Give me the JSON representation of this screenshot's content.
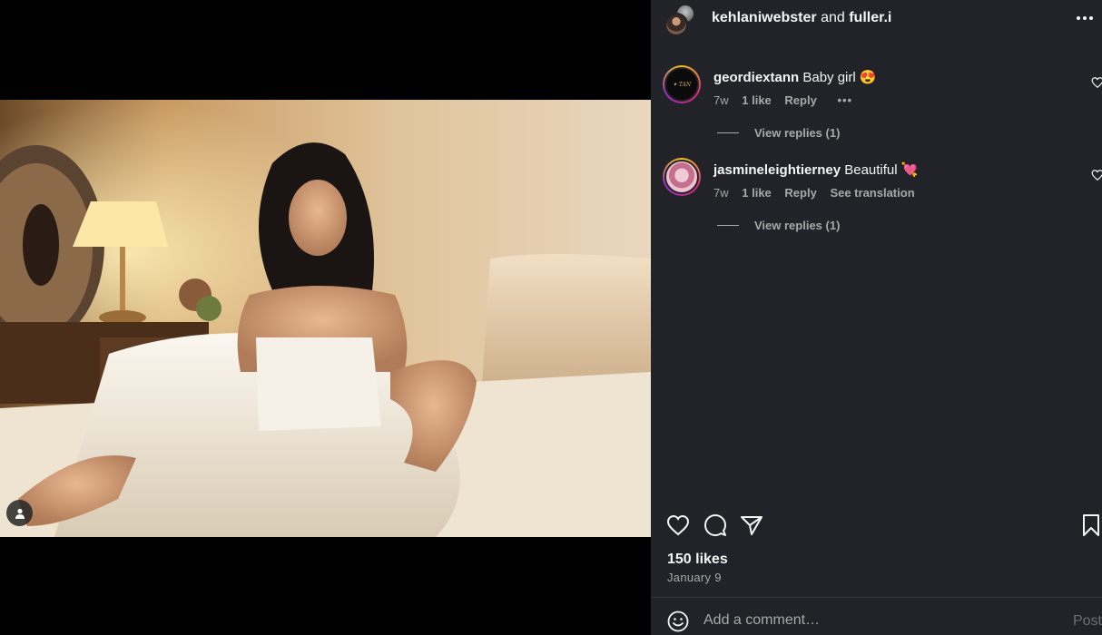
{
  "post": {
    "author": "kehlaniwebster",
    "connector": "and",
    "coauthor": "fuller.i",
    "more_icon": "more-horizontal-icon"
  },
  "media": {
    "alt": "Woman wrapped in white satin sheet sitting on a bed beside a lamp",
    "tag_icon": "user-tag-icon"
  },
  "comments": [
    {
      "user": "geordiextann",
      "text": "Baby girl",
      "emoji": "😍",
      "age": "7w",
      "likes": "1 like",
      "reply": "Reply",
      "extra": "•••",
      "replies": "View replies (1)"
    },
    {
      "user": "jasmineleightierney",
      "text": "Beautiful",
      "emoji": "💘",
      "age": "7w",
      "likes": "1 like",
      "reply": "Reply",
      "extra": "See translation",
      "replies": "View replies (1)"
    }
  ],
  "actions": {
    "like_icon": "heart-icon",
    "comment_icon": "comment-icon",
    "share_icon": "send-icon",
    "save_icon": "bookmark-icon"
  },
  "stats": {
    "likes": "150 likes",
    "date": "January 9"
  },
  "composer": {
    "placeholder": "Add a comment…",
    "post_label": "Post",
    "emoji_icon": "emoji-smile-icon"
  },
  "colors": {
    "panel_bg": "#212328",
    "text_primary": "#f5f5f5",
    "text_secondary": "#a8a8a8",
    "post_disabled": "#6a6f78"
  }
}
